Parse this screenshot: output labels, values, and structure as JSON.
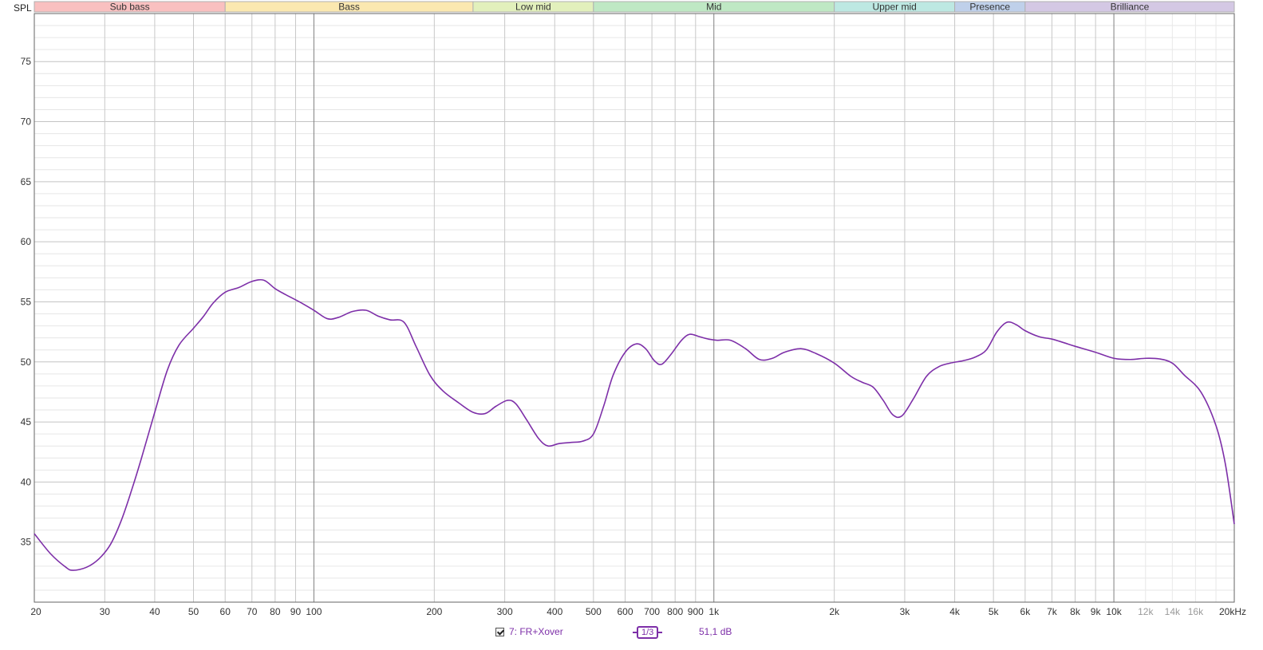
{
  "chart_data": {
    "type": "line",
    "ylabel": "SPL",
    "xscale": "log",
    "xlim": [
      20,
      20000
    ],
    "ylim": [
      30,
      79
    ],
    "grid": true,
    "y_ticks": [
      35,
      40,
      45,
      50,
      55,
      60,
      65,
      70,
      75
    ],
    "x_ticks": [
      {
        "value": 20,
        "label": "20"
      },
      {
        "value": 30,
        "label": "30"
      },
      {
        "value": 40,
        "label": "40"
      },
      {
        "value": 50,
        "label": "50"
      },
      {
        "value": 60,
        "label": "60"
      },
      {
        "value": 70,
        "label": "70"
      },
      {
        "value": 80,
        "label": "80"
      },
      {
        "value": 90,
        "label": "90"
      },
      {
        "value": 100,
        "label": "100"
      },
      {
        "value": 200,
        "label": "200"
      },
      {
        "value": 300,
        "label": "300"
      },
      {
        "value": 400,
        "label": "400"
      },
      {
        "value": 500,
        "label": "500"
      },
      {
        "value": 600,
        "label": "600"
      },
      {
        "value": 700,
        "label": "700"
      },
      {
        "value": 800,
        "label": "800"
      },
      {
        "value": 900,
        "label": "900"
      },
      {
        "value": 1000,
        "label": "1k"
      },
      {
        "value": 2000,
        "label": "2k"
      },
      {
        "value": 3000,
        "label": "3k"
      },
      {
        "value": 4000,
        "label": "4k"
      },
      {
        "value": 5000,
        "label": "5k"
      },
      {
        "value": 6000,
        "label": "6k"
      },
      {
        "value": 7000,
        "label": "7k"
      },
      {
        "value": 8000,
        "label": "8k"
      },
      {
        "value": 9000,
        "label": "9k"
      },
      {
        "value": 10000,
        "label": "10k"
      },
      {
        "value": 12000,
        "label": "12k",
        "faint": true
      },
      {
        "value": 14000,
        "label": "14k",
        "faint": true
      },
      {
        "value": 16000,
        "label": "16k",
        "faint": true
      },
      {
        "value": 20000,
        "label": "20kHz"
      }
    ],
    "bands": [
      {
        "name": "Sub bass",
        "from": 20,
        "to": 60,
        "color": "#f9c0c0"
      },
      {
        "name": "Bass",
        "from": 60,
        "to": 250,
        "color": "#fbe8b0"
      },
      {
        "name": "Low mid",
        "from": 250,
        "to": 500,
        "color": "#e2f0bc"
      },
      {
        "name": "Mid",
        "from": 500,
        "to": 2000,
        "color": "#bfe8c4"
      },
      {
        "name": "Upper mid",
        "from": 2000,
        "to": 4000,
        "color": "#bde8e2"
      },
      {
        "name": "Presence",
        "from": 4000,
        "to": 6000,
        "color": "#bfd0ea"
      },
      {
        "name": "Brilliance",
        "from": 6000,
        "to": 20000,
        "color": "#d4c8e4"
      }
    ],
    "series": [
      {
        "name": "7: FR+Xover",
        "color": "#7d2fa8",
        "points": [
          [
            20,
            35.7
          ],
          [
            22,
            34.0
          ],
          [
            24,
            32.9
          ],
          [
            25,
            32.65
          ],
          [
            27,
            32.9
          ],
          [
            29,
            33.6
          ],
          [
            31,
            34.8
          ],
          [
            33,
            36.8
          ],
          [
            35,
            39.3
          ],
          [
            37,
            41.9
          ],
          [
            40,
            45.8
          ],
          [
            43,
            49.3
          ],
          [
            46,
            51.4
          ],
          [
            50,
            52.8
          ],
          [
            53,
            53.8
          ],
          [
            56,
            54.9
          ],
          [
            60,
            55.8
          ],
          [
            65,
            56.2
          ],
          [
            70,
            56.7
          ],
          [
            75,
            56.8
          ],
          [
            80,
            56.1
          ],
          [
            85,
            55.6
          ],
          [
            92,
            55.0
          ],
          [
            100,
            54.3
          ],
          [
            108,
            53.6
          ],
          [
            115,
            53.7
          ],
          [
            125,
            54.2
          ],
          [
            135,
            54.3
          ],
          [
            145,
            53.8
          ],
          [
            155,
            53.5
          ],
          [
            168,
            53.3
          ],
          [
            180,
            51.3
          ],
          [
            195,
            48.9
          ],
          [
            210,
            47.6
          ],
          [
            230,
            46.6
          ],
          [
            250,
            45.8
          ],
          [
            268,
            45.7
          ],
          [
            285,
            46.3
          ],
          [
            305,
            46.8
          ],
          [
            320,
            46.5
          ],
          [
            340,
            45.2
          ],
          [
            365,
            43.6
          ],
          [
            385,
            43.0
          ],
          [
            410,
            43.2
          ],
          [
            440,
            43.3
          ],
          [
            470,
            43.4
          ],
          [
            500,
            44.0
          ],
          [
            530,
            46.3
          ],
          [
            560,
            48.9
          ],
          [
            600,
            50.8
          ],
          [
            640,
            51.5
          ],
          [
            675,
            51.1
          ],
          [
            710,
            50.1
          ],
          [
            740,
            49.8
          ],
          [
            780,
            50.6
          ],
          [
            830,
            51.8
          ],
          [
            870,
            52.3
          ],
          [
            920,
            52.1
          ],
          [
            970,
            51.9
          ],
          [
            1020,
            51.8
          ],
          [
            1100,
            51.8
          ],
          [
            1200,
            51.1
          ],
          [
            1300,
            50.2
          ],
          [
            1400,
            50.3
          ],
          [
            1500,
            50.8
          ],
          [
            1650,
            51.1
          ],
          [
            1800,
            50.7
          ],
          [
            2000,
            49.9
          ],
          [
            2200,
            48.8
          ],
          [
            2350,
            48.3
          ],
          [
            2500,
            47.9
          ],
          [
            2650,
            46.8
          ],
          [
            2800,
            45.6
          ],
          [
            2950,
            45.5
          ],
          [
            3150,
            46.9
          ],
          [
            3400,
            48.8
          ],
          [
            3650,
            49.6
          ],
          [
            3900,
            49.9
          ],
          [
            4200,
            50.1
          ],
          [
            4500,
            50.4
          ],
          [
            4800,
            51.0
          ],
          [
            5100,
            52.5
          ],
          [
            5400,
            53.3
          ],
          [
            5700,
            53.1
          ],
          [
            6000,
            52.6
          ],
          [
            6500,
            52.1
          ],
          [
            7000,
            51.9
          ],
          [
            7500,
            51.6
          ],
          [
            8000,
            51.3
          ],
          [
            9000,
            50.8
          ],
          [
            10000,
            50.3
          ],
          [
            11000,
            50.2
          ],
          [
            12000,
            50.3
          ],
          [
            13000,
            50.25
          ],
          [
            14000,
            49.9
          ],
          [
            15000,
            48.9
          ],
          [
            16500,
            47.5
          ],
          [
            18000,
            44.7
          ],
          [
            19000,
            41.5
          ],
          [
            20000,
            36.5
          ]
        ]
      }
    ],
    "smoothing": "1/3",
    "value_readout": "51,1 dB"
  }
}
